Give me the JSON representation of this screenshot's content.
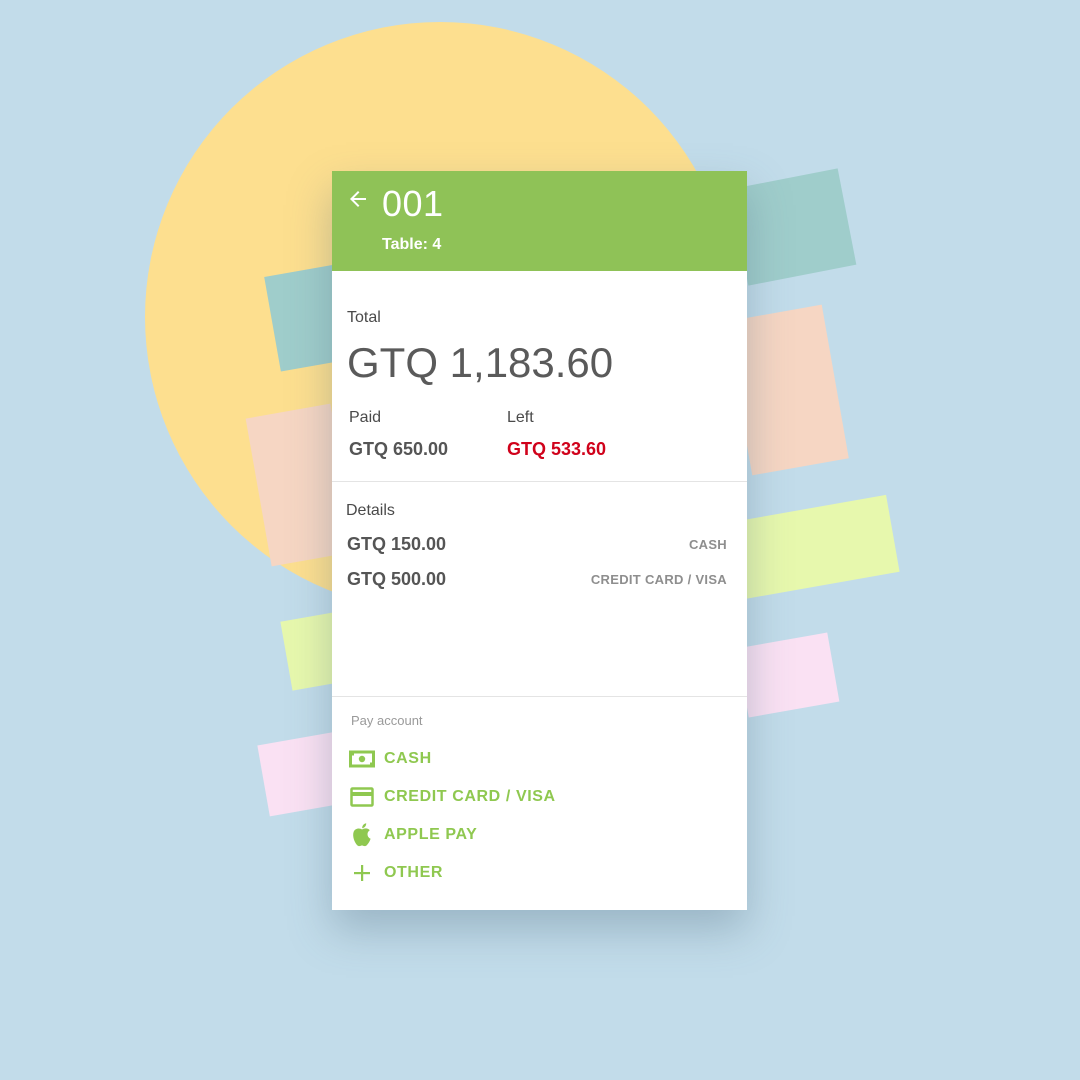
{
  "header": {
    "order_number": "001",
    "table": "Table: 4"
  },
  "summary": {
    "total_label": "Total",
    "total_value": "GTQ 1,183.60",
    "paid_label": "Paid",
    "paid_value": "GTQ 650.00",
    "left_label": "Left",
    "left_value": "GTQ 533.60"
  },
  "details": {
    "label": "Details",
    "rows": [
      {
        "amount": "GTQ 150.00",
        "method": "CASH"
      },
      {
        "amount": "GTQ 500.00",
        "method": "CREDIT CARD / VISA"
      }
    ]
  },
  "pay_account": {
    "label": "Pay account",
    "options": [
      {
        "label": "CASH",
        "icon": "cash-icon"
      },
      {
        "label": "CREDIT CARD / VISA",
        "icon": "credit-card-icon"
      },
      {
        "label": "APPLE PAY",
        "icon": "apple-icon"
      },
      {
        "label": "OTHER",
        "icon": "plus-icon"
      }
    ]
  },
  "colors": {
    "header_green": "#8fc257",
    "accent_green": "#8fc850",
    "left_red": "#d0021b",
    "background": "#c2dcea"
  }
}
